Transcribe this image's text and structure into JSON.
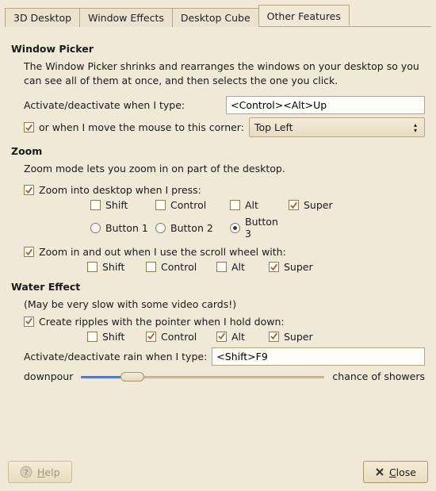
{
  "tabs": [
    "3D Desktop",
    "Window Effects",
    "Desktop Cube",
    "Other Features"
  ],
  "active_tab_index": 3,
  "window_picker": {
    "title": "Window Picker",
    "description": "The Window Picker shrinks and rearranges the windows on your desktop so you can see all of them at once, and then selects the one you click.",
    "activate_label": "Activate/deactivate when I type:",
    "activate_shortcut": "<Control><Alt>Up",
    "corner_enabled": true,
    "corner_label": "or when I move the mouse to this corner:",
    "corner_value": "Top Left"
  },
  "zoom": {
    "title": "Zoom",
    "description": "Zoom mode lets you zoom in on part of the desktop.",
    "into_enabled": true,
    "into_label": "Zoom into desktop when I press:",
    "mods": {
      "shift": false,
      "control": false,
      "alt": false,
      "super": true
    },
    "button_selected": "Button 3",
    "buttons": [
      "Button 1",
      "Button 2",
      "Button 3"
    ],
    "scroll_enabled": true,
    "scroll_label": "Zoom in and out when I use the scroll wheel with:",
    "scroll_mods": {
      "shift": false,
      "control": false,
      "alt": false,
      "super": true
    }
  },
  "water": {
    "title": "Water Effect",
    "note": "(May be very slow with some video cards!)",
    "ripples_enabled": true,
    "ripples_label": "Create ripples with the pointer when I hold down:",
    "mods": {
      "shift": false,
      "control": true,
      "alt": true,
      "super": true
    },
    "rain_label": "Activate/deactivate rain when I type:",
    "rain_shortcut": "<Shift>F9",
    "slider_left": "downpour",
    "slider_right": "chance of showers",
    "slider_percent": 21
  },
  "labels": {
    "shift": "Shift",
    "control": "Control",
    "alt": "Alt",
    "super": "Super"
  },
  "buttons": {
    "help": "Help",
    "close": "Close"
  }
}
